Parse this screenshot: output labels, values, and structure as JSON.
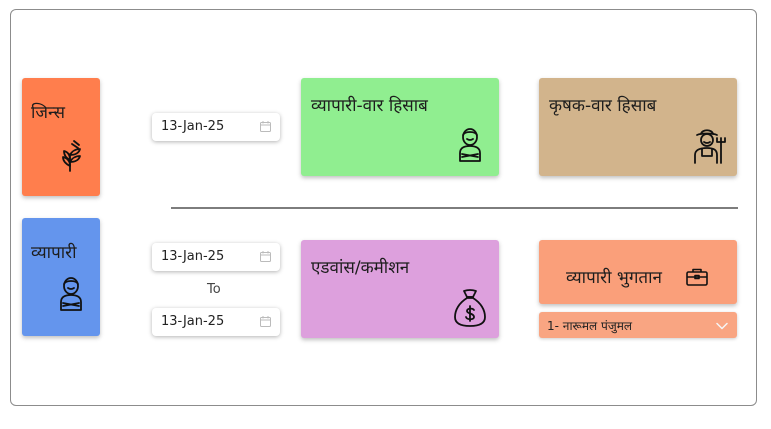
{
  "tiles": {
    "jins": {
      "label": "जिन्स",
      "icon": "wheat-icon",
      "color": "#ff7e4d"
    },
    "vyapari": {
      "label": "व्यापारी",
      "icon": "person-arms-crossed-icon",
      "color": "#6495ed"
    },
    "vyapari_war": {
      "label": "व्यापारी-वार हिसाब",
      "icon": "person-arms-crossed-icon",
      "color": "#90ee90"
    },
    "krishak_war": {
      "label": "कृषक-वार हिसाब",
      "icon": "farmer-icon",
      "color": "#d2b48c"
    },
    "advance": {
      "label": "एडवांस/कमीशन",
      "icon": "money-bag-icon",
      "color": "#dda0dd"
    },
    "bhugtan": {
      "label": "व्यापारी भुगतान",
      "icon": "briefcase-icon",
      "color": "#fa9f7a"
    }
  },
  "dates": {
    "single": "13-Jan-25",
    "from": "13-Jan-25",
    "to_label": "To",
    "to": "13-Jan-25"
  },
  "vyapari_select": {
    "value": "1- नारूमल पंजुमल"
  }
}
